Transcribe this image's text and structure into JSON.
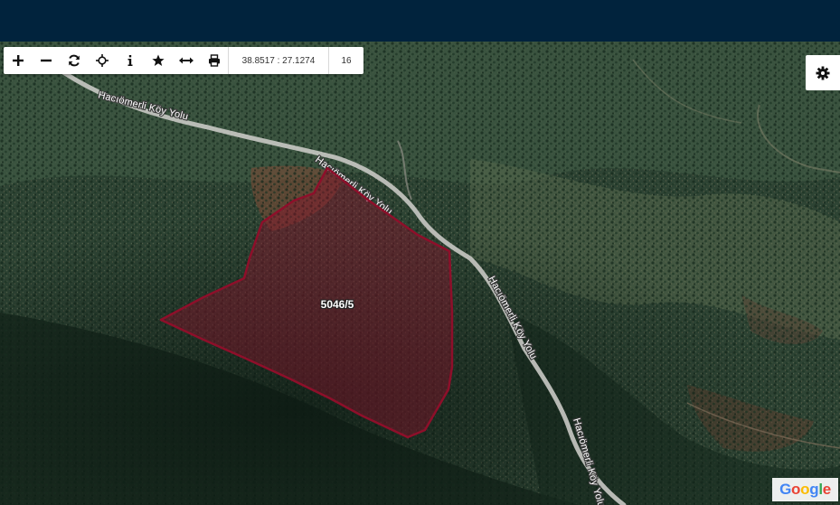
{
  "toolbar": {
    "tools": [
      {
        "name": "zoom-in-icon",
        "glyph": "plus"
      },
      {
        "name": "zoom-out-icon",
        "glyph": "minus"
      },
      {
        "name": "refresh-icon",
        "glyph": "refresh"
      },
      {
        "name": "locate-icon",
        "glyph": "crosshair"
      },
      {
        "name": "info-icon",
        "glyph": "info"
      },
      {
        "name": "favorite-icon",
        "glyph": "star"
      },
      {
        "name": "measure-icon",
        "glyph": "arrows-horizontal"
      },
      {
        "name": "print-icon",
        "glyph": "printer"
      }
    ],
    "coordinates": "38.8517 : 27.1274",
    "zoom_level": "16"
  },
  "settings": {
    "icon": "gear-icon"
  },
  "map": {
    "road_labels": [
      "Hacıömerli Köy Yolu",
      "Hacıömerli Köy Yolu",
      "Hacıömerli Köy Yolu",
      "Hacıömerli Köy Yolu"
    ],
    "parcel_label": "5046/5",
    "parcel_color": "#8e0f2a",
    "imagery_brand": "Google"
  },
  "colors": {
    "header": "#01233d",
    "brand_blue": "#4285F4",
    "brand_red": "#EA4335",
    "brand_yellow": "#FBBC05",
    "brand_green": "#34A853"
  }
}
